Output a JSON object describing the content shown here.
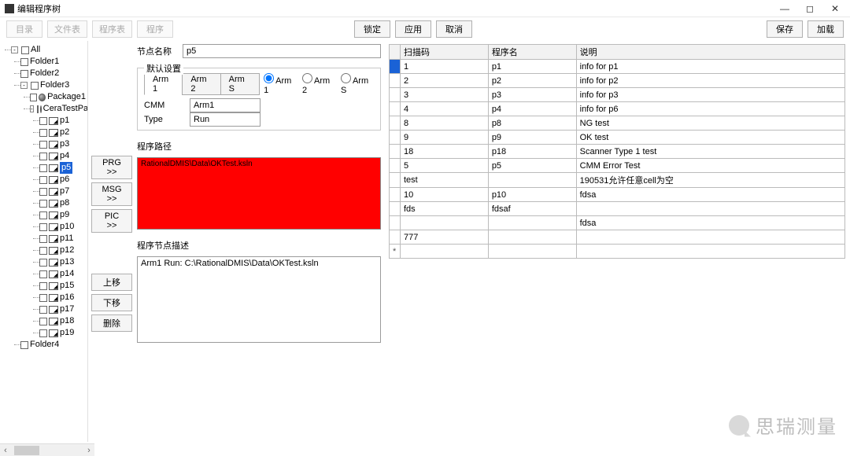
{
  "window": {
    "title": "编辑程序树",
    "minimize": "—",
    "maximize": "◻",
    "close": "✕"
  },
  "toolbar": {
    "btn_dir": "目录",
    "btn_filetable": "文件表",
    "btn_proglist": "程序表",
    "btn_prog": "程序",
    "btn_lock": "锁定",
    "btn_apply": "应用",
    "btn_cancel": "取消",
    "btn_save": "保存",
    "btn_load": "加载"
  },
  "tree": {
    "root": "All",
    "folders": [
      "Folder1",
      "Folder2",
      "Folder3"
    ],
    "folder3_children": {
      "package1": "Package1",
      "ceratest": "CeraTestPack"
    },
    "programs": [
      "p1",
      "p2",
      "p3",
      "p4",
      "p5",
      "p6",
      "p7",
      "p8",
      "p9",
      "p10",
      "p11",
      "p12",
      "p13",
      "p14",
      "p15",
      "p16",
      "p17",
      "p18",
      "p19"
    ],
    "selected": "p5",
    "folder4": "Folder4"
  },
  "form": {
    "node_name_label": "节点名称",
    "node_name_value": "p5",
    "default_group_label": "默认设置",
    "arm_tabs": [
      "Arm 1",
      "Arm 2",
      "Arm S"
    ],
    "arm_radios": [
      "Arm 1",
      "Arm 2",
      "Arm S"
    ],
    "arm_selected": "Arm 1",
    "cmm_label": "CMM",
    "cmm_value": "Arm1",
    "type_label": "Type",
    "type_value": "Run",
    "prog_path_label": "程序路径",
    "prog_path_value": "RationalDMIS\\Data\\OKTest.ksln",
    "side_btns": {
      "prg": "PRG >>",
      "msg": "MSG >>",
      "pic": "PIC >>",
      "up": "上移",
      "down": "下移",
      "del": "删除"
    },
    "desc_label": "程序节点描述",
    "desc_value": "Arm1 Run: C:\\RationalDMIS\\Data\\OKTest.ksln"
  },
  "table": {
    "headers": [
      "扫描码",
      "程序名",
      "说明"
    ],
    "rows": [
      {
        "c0": "1",
        "c1": "p1",
        "c2": "info for p1",
        "sel": true
      },
      {
        "c0": "2",
        "c1": "p2",
        "c2": "info for p2"
      },
      {
        "c0": "3",
        "c1": "p3",
        "c2": "info for p3"
      },
      {
        "c0": "4",
        "c1": "p4",
        "c2": "info for p6"
      },
      {
        "c0": "8",
        "c1": "p8",
        "c2": "NG test"
      },
      {
        "c0": "9",
        "c1": "p9",
        "c2": "OK test"
      },
      {
        "c0": "18",
        "c1": "p18",
        "c2": "Scanner Type 1 test"
      },
      {
        "c0": "5",
        "c1": "p5",
        "c2": "CMM Error Test"
      },
      {
        "c0": "test",
        "c1": "",
        "c2": "190531允许任意cell为空"
      },
      {
        "c0": "10",
        "c1": "p10",
        "c2": "fdsa"
      },
      {
        "c0": "fds",
        "c1": "fdsaf",
        "c2": ""
      },
      {
        "c0": "",
        "c1": "",
        "c2": "fdsa"
      },
      {
        "c0": "777",
        "c1": "",
        "c2": ""
      }
    ],
    "star": "*"
  },
  "watermark": "思瑞测量"
}
